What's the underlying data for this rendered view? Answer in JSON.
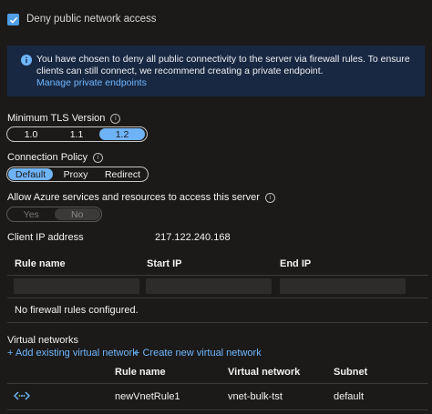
{
  "deny_public": {
    "label": "Deny public network access",
    "checked": true
  },
  "info": {
    "text": "You have chosen to deny all public connectivity to the server via firewall rules. To ensure clients can still connect, we recommend creating a private endpoint.",
    "link": "Manage private endpoints"
  },
  "tls": {
    "label": "Minimum TLS Version",
    "options": [
      "1.0",
      "1.1",
      "1.2"
    ],
    "selected": "1.2"
  },
  "connection_policy": {
    "label": "Connection Policy",
    "options": [
      "Default",
      "Proxy",
      "Redirect"
    ],
    "selected": "Default"
  },
  "allow_azure": {
    "label": "Allow Azure services and resources to access this server",
    "options": [
      "Yes",
      "No"
    ],
    "selected": "No"
  },
  "client_ip": {
    "label": "Client IP address",
    "value": "217.122.240.168"
  },
  "firewall": {
    "headers": [
      "Rule name",
      "Start IP",
      "End IP"
    ],
    "empty_text": "No firewall rules configured."
  },
  "vnet": {
    "title": "Virtual networks",
    "add_existing": "+ Add existing virtual network",
    "create_new": "+ Create new virtual network",
    "headers": [
      "Rule name",
      "Virtual network",
      "Subnet"
    ],
    "rows": [
      {
        "icon": "vnet-icon",
        "rule_name": "newVnetRule1",
        "virtual_network": "vnet-bulk-tst",
        "subnet": "default"
      }
    ]
  },
  "colors": {
    "accent": "#6fb3f7",
    "link": "#6fb7ff",
    "info_bg": "#192842",
    "bg": "#1b1a19"
  }
}
